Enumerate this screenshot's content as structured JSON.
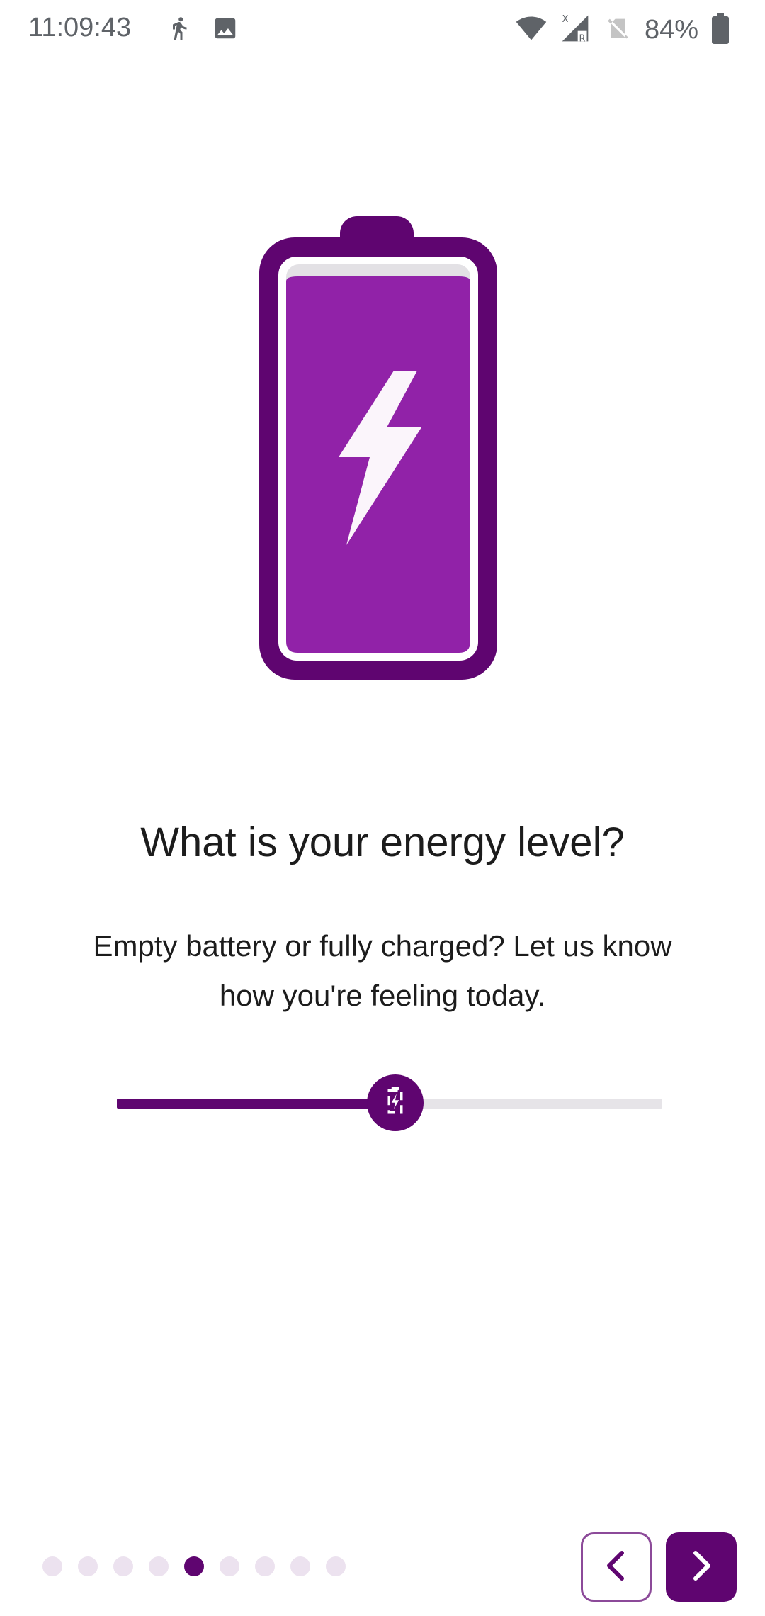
{
  "status_bar": {
    "time": "11:09:43",
    "battery_percent": "84%",
    "icons": [
      "walking-icon",
      "image-icon",
      "wifi-icon",
      "signal-icon",
      "no-sim-icon",
      "battery-icon"
    ]
  },
  "illustration": {
    "name": "battery-charging-icon",
    "colors": {
      "outline": "#5f0570",
      "fill": "#9122a8",
      "bolt": "#fbf5fb",
      "empty": "#e3e1e5"
    }
  },
  "question": {
    "title": "What is your energy level?",
    "subtitle": "Empty battery or fully charged? Let us know how you're feeling today."
  },
  "slider": {
    "value_fraction": 0.51,
    "thumb_icon": "battery-charging-icon",
    "accent": "#5f0570",
    "track": "#e6e4e8"
  },
  "pager": {
    "total": 9,
    "active_index": 4
  },
  "nav": {
    "back_icon": "chevron-left-icon",
    "next_icon": "chevron-right-icon"
  }
}
